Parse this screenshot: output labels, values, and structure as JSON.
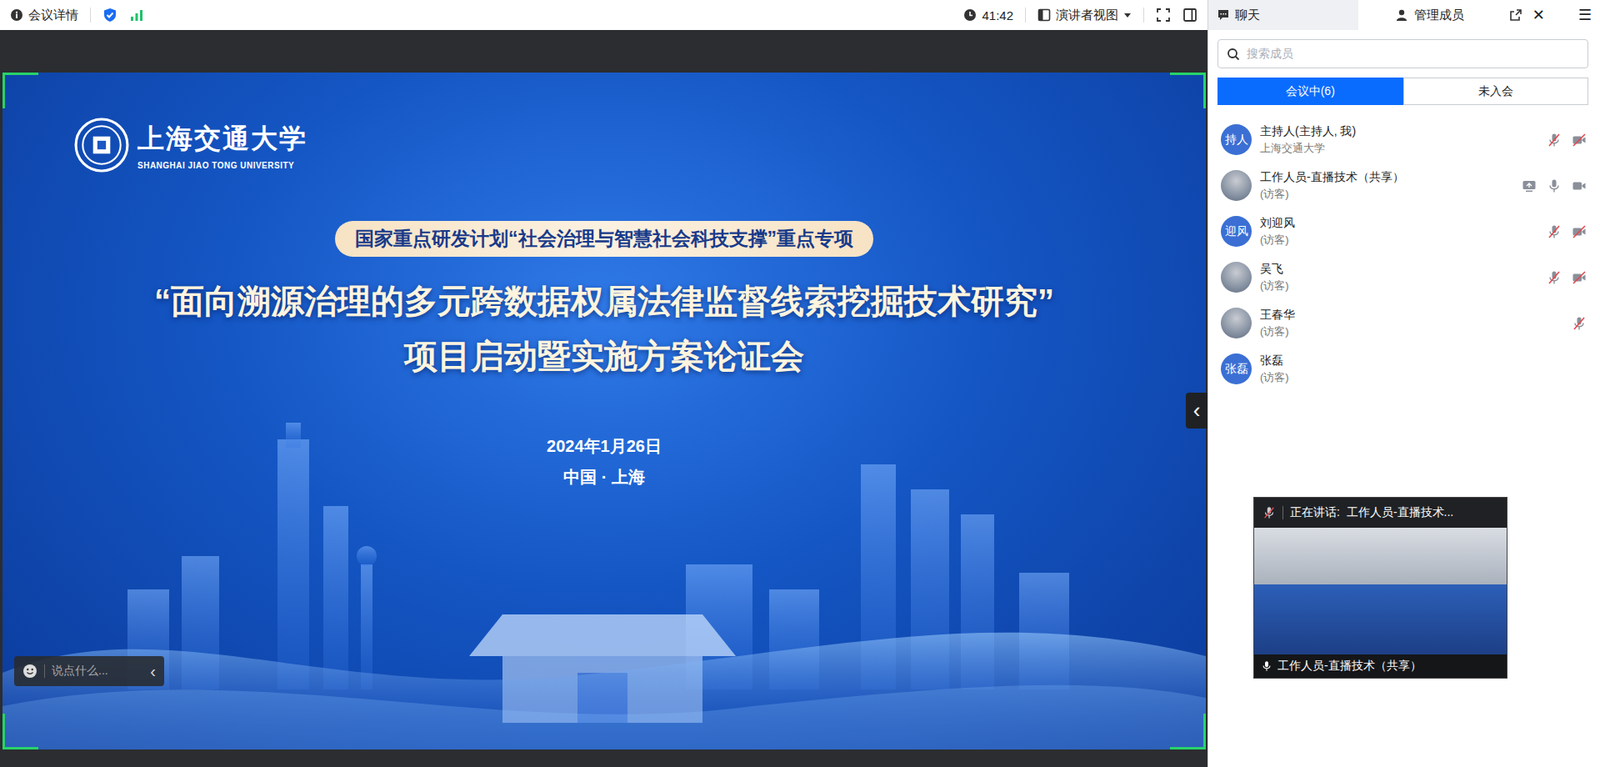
{
  "topbar": {
    "meeting_info": "会议详情",
    "timer": "41:42",
    "view_mode": "演讲者视图"
  },
  "slide": {
    "logo_cn": "上海交通大学",
    "logo_en": "SHANGHAI JIAO TONG UNIVERSITY",
    "program": "国家重点研发计划“社会治理与智慧社会科技支撑”重点专项",
    "title_lines": [
      "“面向溯源治理的多元跨数据权属法律监督线索挖掘技术研究”",
      "项目启动暨实施方案论证会"
    ],
    "date": "2024年1月26日",
    "place": "中国 · 上海"
  },
  "chat_input": {
    "placeholder": "说点什么...",
    "collapse_glyph": "‹"
  },
  "panel_toggle": {
    "glyph": "‹"
  },
  "side_panel": {
    "tabs": [
      {
        "label": "聊天",
        "selected": false
      },
      {
        "label": "管理成员",
        "selected": true
      }
    ],
    "close_glyph": "✕",
    "menu_glyph": "☰"
  },
  "search": {
    "placeholder": "搜索成员"
  },
  "segments": [
    {
      "label": "会议中(6)",
      "selected": true
    },
    {
      "label": "未入会",
      "selected": false
    }
  ],
  "members": [
    {
      "name": "主持人(主持人, 我)",
      "role": "上海交通大学",
      "avatar_text": "持人",
      "avatar_kind": "initials",
      "sharing": false,
      "mic": "muted",
      "camera": "off"
    },
    {
      "name": "工作人员-直播技术（共享）",
      "role": "(访客)",
      "avatar_text": "",
      "avatar_kind": "photo",
      "sharing": true,
      "mic": "on",
      "camera": "on"
    },
    {
      "name": "刘迎风",
      "role": "(访客)",
      "avatar_text": "迎风",
      "avatar_kind": "initials",
      "sharing": false,
      "mic": "muted",
      "camera": "off"
    },
    {
      "name": "吴飞",
      "role": "(访客)",
      "avatar_text": "",
      "avatar_kind": "photo",
      "sharing": false,
      "mic": "muted",
      "camera": "off"
    },
    {
      "name": "王春华",
      "role": "(访客)",
      "avatar_text": "",
      "avatar_kind": "photo",
      "sharing": false,
      "mic": "muted",
      "camera": "none"
    },
    {
      "name": "张磊",
      "role": "(访客)",
      "avatar_text": "张磊",
      "avatar_kind": "initials",
      "sharing": false,
      "mic": "none",
      "camera": "none"
    }
  ],
  "speaker_window": {
    "prefix": "正在讲话:",
    "speaker": "工作人员-直播技术...",
    "mic_muted": true,
    "label": "工作人员-直播技术（共享）"
  }
}
